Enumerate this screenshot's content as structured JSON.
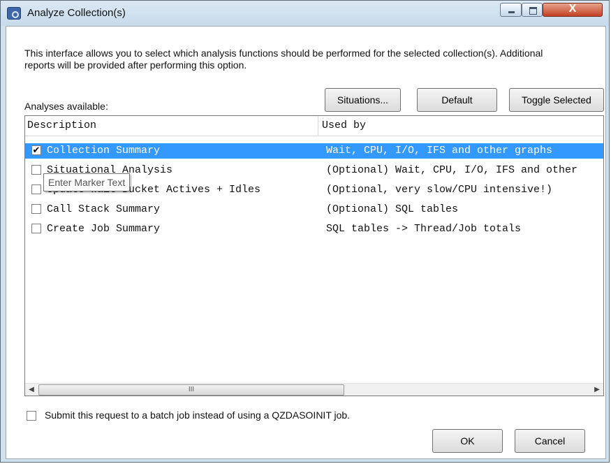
{
  "window": {
    "title": "Analyze Collection(s)",
    "close_symbol": "X"
  },
  "intro": "This interface allows you to select which analysis functions should be performed for the selected collection(s).  Additional reports will be provided after performing this option.",
  "analyses_label": "Analyses available:",
  "buttons": {
    "situations": "Situations...",
    "default": "Default",
    "toggle_selected": "Toggle Selected",
    "ok": "OK",
    "cancel": "Cancel"
  },
  "columns": {
    "description": "Description",
    "used_by": "Used by"
  },
  "rows": [
    {
      "checked": true,
      "checkmark": "✔",
      "description": "Collection Summary",
      "used_by": "Wait, CPU, I/O, IFS and other graphs",
      "selected": true
    },
    {
      "checked": false,
      "checkmark": "",
      "description": "Situational Analysis",
      "used_by": "(Optional) Wait, CPU, I/O, IFS and other",
      "selected": false
    },
    {
      "checked": false,
      "checkmark": "",
      "description": "Update Wait Bucket Actives + Idles",
      "used_by": "(Optional, very slow/CPU intensive!)",
      "selected": false
    },
    {
      "checked": false,
      "checkmark": "",
      "description": "Call Stack Summary",
      "used_by": "(Optional) SQL tables",
      "selected": false
    },
    {
      "checked": false,
      "checkmark": "",
      "description": "Create Job Summary",
      "used_by": "SQL tables -> Thread/Job totals",
      "selected": false
    }
  ],
  "tooltip": "Enter Marker Text",
  "scrollbar": {
    "left_arrow": "◀",
    "right_arrow": "▶",
    "thumb_grip": "III"
  },
  "batch_option": {
    "checked": false,
    "label": "Submit this request to a batch job instead of using a QZDASOINIT job."
  }
}
